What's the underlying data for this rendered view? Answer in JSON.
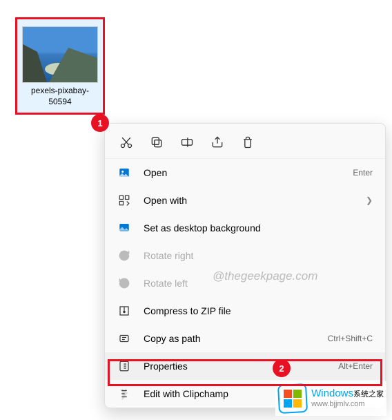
{
  "file": {
    "name": "pexels-pixabay-50594"
  },
  "badges": {
    "one": "1",
    "two": "2"
  },
  "quickActions": {
    "cut": "cut-icon",
    "copy": "copy-icon",
    "rename": "rename-icon",
    "share": "share-icon",
    "delete": "delete-icon"
  },
  "menu": {
    "open": {
      "label": "Open",
      "shortcut": "Enter"
    },
    "openWith": {
      "label": "Open with"
    },
    "setBg": {
      "label": "Set as desktop background"
    },
    "rotateRight": {
      "label": "Rotate right"
    },
    "rotateLeft": {
      "label": "Rotate left"
    },
    "compress": {
      "label": "Compress to ZIP file"
    },
    "copyPath": {
      "label": "Copy as path",
      "shortcut": "Ctrl+Shift+C"
    },
    "properties": {
      "label": "Properties",
      "shortcut": "Alt+Enter"
    },
    "clipchamp": {
      "label": "Edit with Clipchamp"
    }
  },
  "watermark": "@thegeekpage.com",
  "footer": {
    "brand": "Windows",
    "brandSuffix": "系统之家",
    "url": "www.bjjmlv.com"
  }
}
